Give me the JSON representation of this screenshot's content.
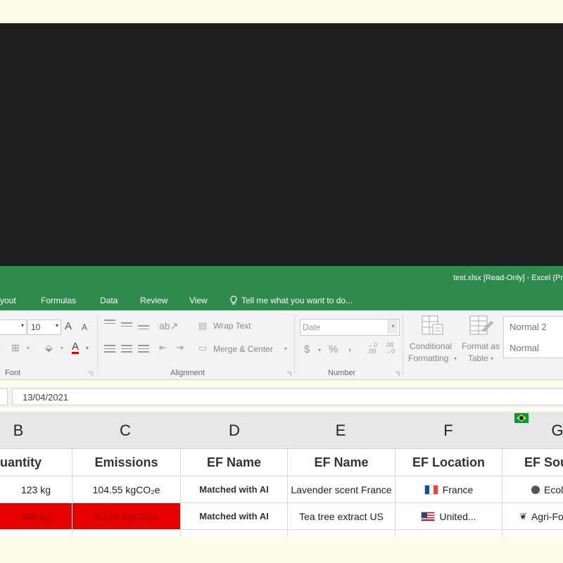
{
  "window": {
    "title": "test.xlsx [Read-Only] - Excel (Pr"
  },
  "tabs": [
    {
      "label": "yout"
    },
    {
      "label": "Formulas"
    },
    {
      "label": "Data"
    },
    {
      "label": "Review"
    },
    {
      "label": "View"
    }
  ],
  "tellme": {
    "label": "Tell me what you want to do..."
  },
  "ribbon": {
    "font": {
      "size": "10",
      "grow": "A",
      "shrink": "A",
      "color_letter": "A",
      "group_label": "Font"
    },
    "alignment": {
      "wrap_text": "Wrap Text",
      "merge_center": "Merge & Center",
      "group_label": "Alignment"
    },
    "number": {
      "format_placeholder": "Date",
      "currency": "$",
      "percent": "%",
      "comma": ",",
      "group_label": "Number"
    },
    "styles": {
      "conditional_1": "Conditional",
      "conditional_2": "Formatting",
      "format_as_1": "Format as",
      "format_as_2": "Table",
      "style1": "Normal 2",
      "style2": "Normal"
    }
  },
  "formula_bar": {
    "value": "13/04/2021"
  },
  "columns": [
    "B",
    "C",
    "D",
    "E",
    "F",
    "G"
  ],
  "sheet": {
    "headers": {
      "b": "uantity",
      "c": "Emissions",
      "d": "EF Name",
      "e": "EF Name",
      "f": "EF Location",
      "g": "EF Sou"
    },
    "row1": {
      "b": "123 kg",
      "c": "104.55 kgCO₂e",
      "d": "Matched with AI",
      "e": "Lavender scent France",
      "f": "France",
      "g": "Ecol"
    },
    "row2": {
      "b": "340 kg",
      "c": "5,220 kgCO₂e",
      "d": "Matched with AI",
      "e": "Tea tree extract US",
      "f": "United...",
      "g": "Agri-Fo"
    }
  },
  "colors": {
    "excel_green": "#2e8a4d",
    "highlight_red": "#e60000"
  }
}
